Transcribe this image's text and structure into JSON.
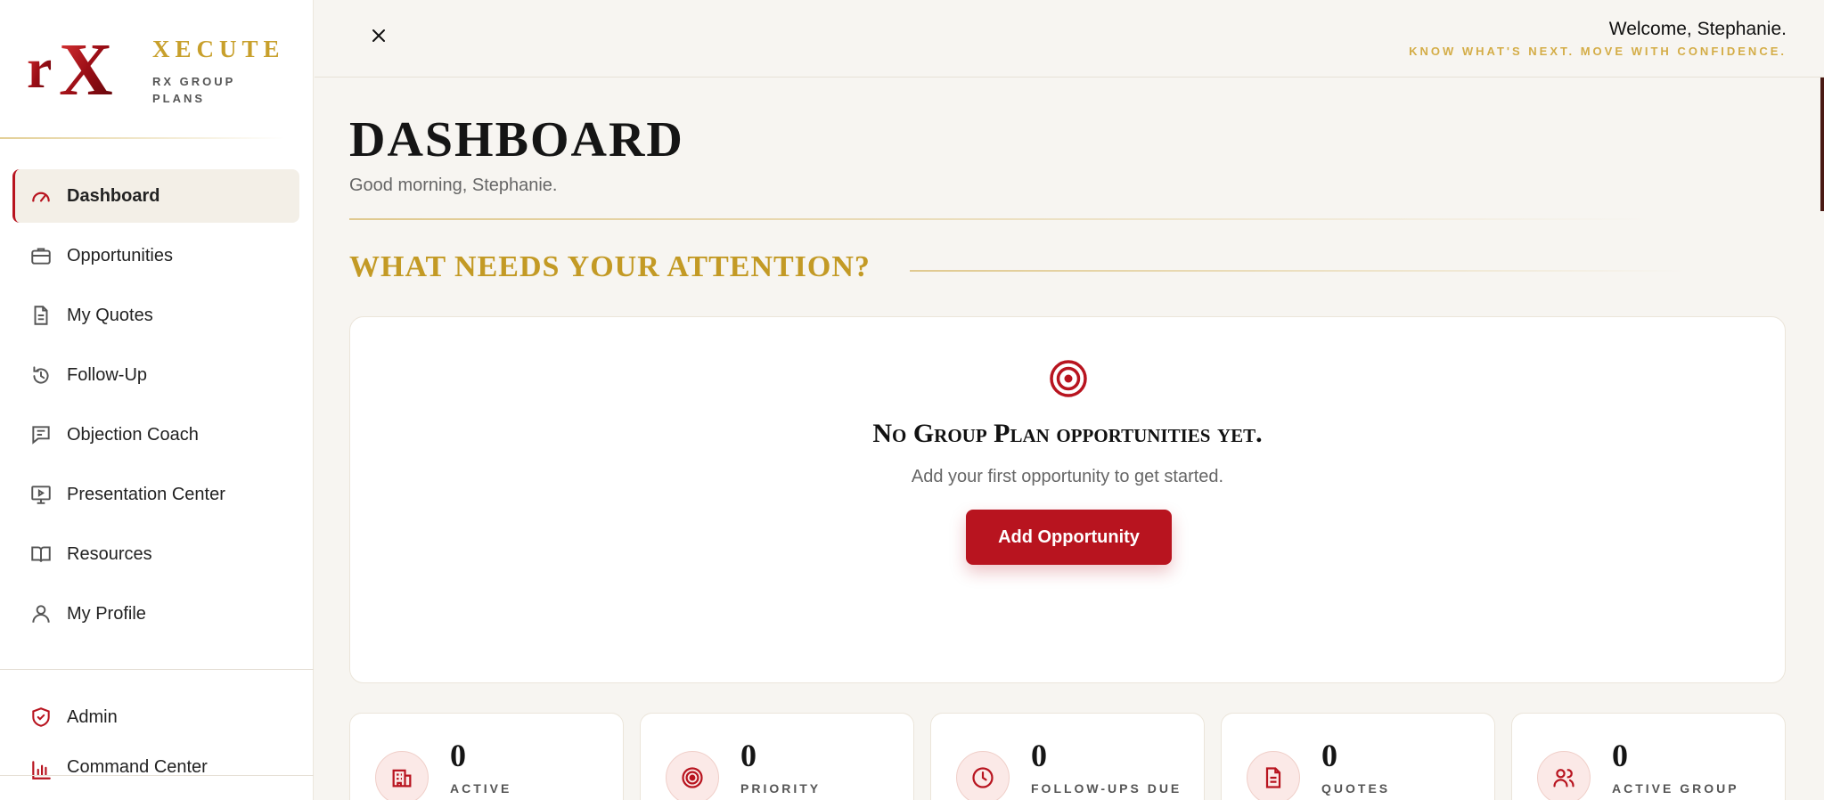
{
  "brand": {
    "logo_text": "rX",
    "name": "XECUTE",
    "subtitle": "RX GROUP PLANS"
  },
  "sidebar": {
    "items": [
      {
        "label": "Dashboard",
        "icon": "gauge-icon",
        "active": true
      },
      {
        "label": "Opportunities",
        "icon": "briefcase-icon",
        "active": false
      },
      {
        "label": "My Quotes",
        "icon": "document-icon",
        "active": false
      },
      {
        "label": "Follow-Up",
        "icon": "clock-history-icon",
        "active": false
      },
      {
        "label": "Objection Coach",
        "icon": "message-icon",
        "active": false
      },
      {
        "label": "Presentation Center",
        "icon": "presentation-icon",
        "active": false
      },
      {
        "label": "Resources",
        "icon": "book-icon",
        "active": false
      },
      {
        "label": "My Profile",
        "icon": "user-icon",
        "active": false
      }
    ],
    "bottom_items": [
      {
        "label": "Admin",
        "icon": "shield-check-icon"
      },
      {
        "label": "Command Center",
        "icon": "bar-chart-icon"
      }
    ]
  },
  "header": {
    "welcome": "Welcome, Stephanie.",
    "tagline": "KNOW WHAT'S NEXT. MOVE WITH CONFIDENCE."
  },
  "main": {
    "title": "DASHBOARD",
    "greeting": "Good morning, Stephanie.",
    "section_title": "WHAT NEEDS YOUR ATTENTION?",
    "empty_state": {
      "title": "No Group Plan opportunities yet.",
      "subtitle": "Add your first opportunity to get started.",
      "button_label": "Add Opportunity"
    },
    "stats": [
      {
        "value": "0",
        "label": "Active Opportunities",
        "icon": "building-icon"
      },
      {
        "value": "0",
        "label": "Priority Accounts",
        "icon": "target-icon"
      },
      {
        "value": "0",
        "label": "Follow-Ups Due",
        "icon": "clock-icon"
      },
      {
        "value": "0",
        "label": "Quotes Submitted",
        "icon": "document-icon"
      },
      {
        "value": "0",
        "label": "Active Group Accounts",
        "icon": "users-icon"
      }
    ]
  },
  "colors": {
    "accent_red": "#b8141f",
    "gold": "#c39a25",
    "background": "#f7f5f1"
  }
}
